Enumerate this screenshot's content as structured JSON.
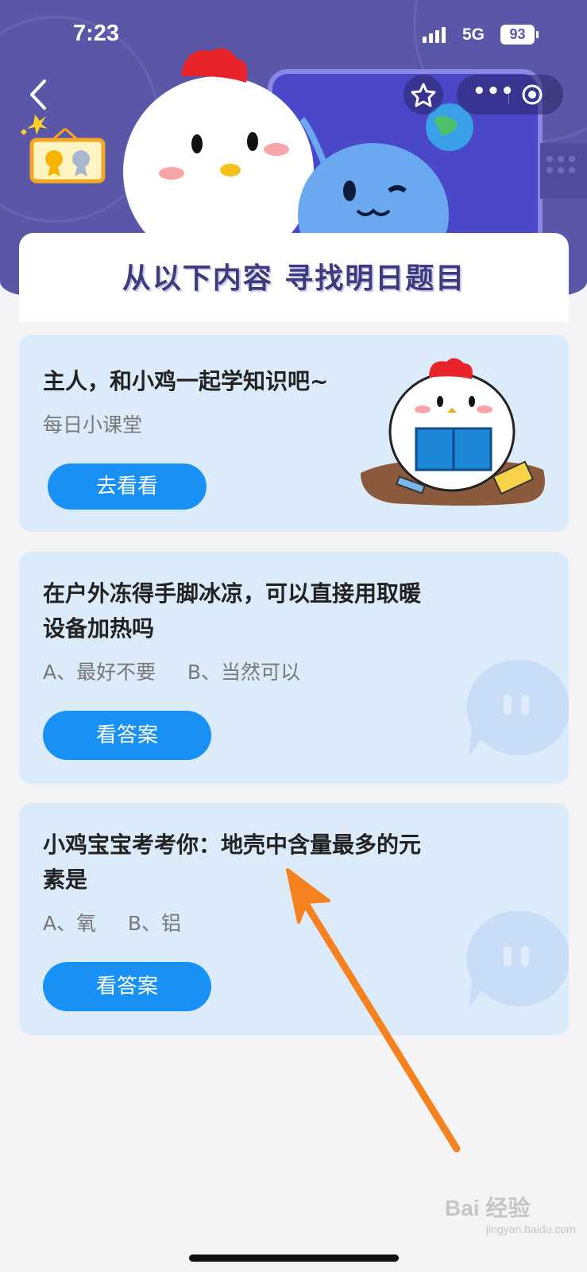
{
  "status_bar": {
    "time": "7:23",
    "network": "5G",
    "battery": "93"
  },
  "header": {
    "banner_title": "从以下内容 寻找明日题目"
  },
  "cards": [
    {
      "title": "主人，和小鸡一起学知识吧~",
      "subtitle": "每日小课堂",
      "button": "去看看"
    },
    {
      "title_line1": "在户外冻得手脚冰凉，可以直接用取暖",
      "title_line2": "设备加热吗",
      "options": "A、最好不要     B、当然可以",
      "button": "看答案"
    },
    {
      "title_line1": "小鸡宝宝考考你：地壳中含量最多的元",
      "title_line2": "素是",
      "options": "A、氧     B、铝",
      "button": "看答案"
    }
  ],
  "watermark": {
    "brand": "Bai 经验",
    "url": "jingyan.baidu.com"
  },
  "colors": {
    "header_bg": "#5a57a8",
    "card_bg": "#dcebfa",
    "button": "#1890f4",
    "arrow": "#f5821f"
  }
}
